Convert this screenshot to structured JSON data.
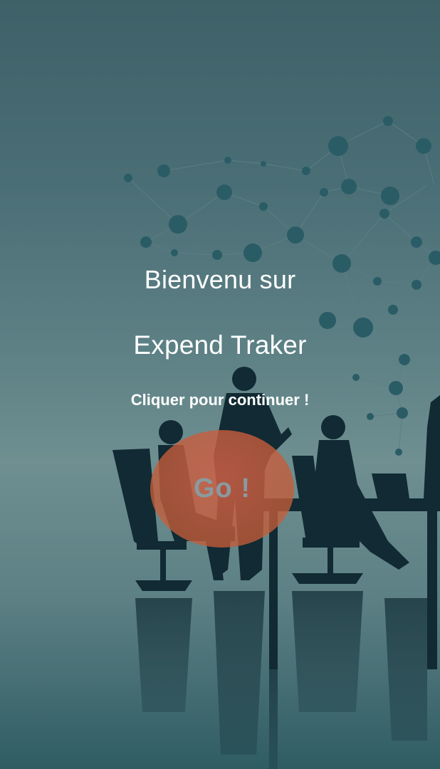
{
  "welcome": {
    "line1": "Bienvenu sur",
    "app_name": "Expend Traker",
    "hint": "Cliquer pour continuer !"
  },
  "go_button": {
    "label": "Go !"
  },
  "colors": {
    "background": "#4b6f76",
    "button_fill": "#c45c38",
    "button_text": "#8a9aa0",
    "text": "#ffffff",
    "network_node": "#2a5c66"
  }
}
